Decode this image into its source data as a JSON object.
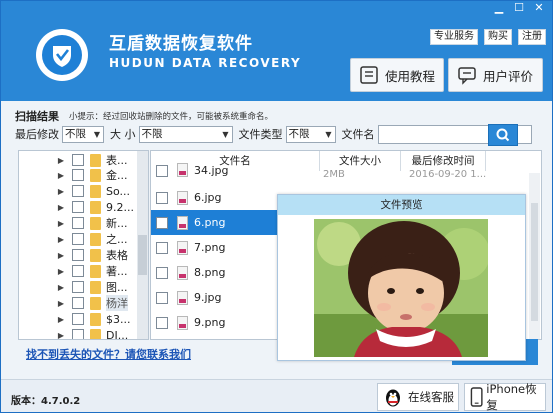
{
  "window": {
    "title_cn": "互盾数据恢复软件",
    "title_en": "HUDUN DATA RECOVERY",
    "controls": {
      "minimize": "▁",
      "maximize": "☐",
      "close": "✕"
    },
    "links": [
      "专业服务",
      "购买",
      "注册"
    ]
  },
  "header_buttons": {
    "tutorial": "使用教程",
    "review": "用户评价"
  },
  "search": {
    "result_title": "扫描结果",
    "tip": "小提示：经过回收站删除的文件，可能被系统重命名。",
    "modified_label": "最后修改",
    "modified_value": "不限",
    "size_label": "大 小",
    "size_value": "不限",
    "type_label": "文件类型",
    "type_value": "不限",
    "name_label": "文件名",
    "name_value": ""
  },
  "tree": {
    "items": [
      "表...",
      "金...",
      "So...",
      "9.2...",
      "新...",
      "之...",
      "表格",
      "著...",
      "图...",
      "杨洋",
      "$3...",
      "DI..."
    ]
  },
  "file_list": {
    "headers": {
      "name": "文件名",
      "size": "文件大小",
      "modified": "最后修改时间"
    },
    "partial_row": {
      "name": "34.jpg",
      "size": "2MB",
      "date": "2016-09-20 1..."
    },
    "rows": [
      {
        "name": "6.jpg",
        "selected": false
      },
      {
        "name": "6.png",
        "selected": true
      },
      {
        "name": "7.png",
        "selected": false
      },
      {
        "name": "8.png",
        "selected": false
      },
      {
        "name": "9.jpg",
        "selected": false
      },
      {
        "name": "9.png",
        "selected": false
      }
    ]
  },
  "preview": {
    "title": "文件预览"
  },
  "footer": {
    "help_link": "找不到丢失的文件？请您联系我们",
    "version": "版本：4.7.0.2",
    "online_service": "在线客服",
    "iphone_recovery": "iPhone恢复"
  },
  "colors": {
    "brand_blue": "#2a87d6",
    "selection_blue": "#1e7fd6",
    "folder_yellow": "#f1c14a"
  },
  "icons": [
    "shield-logo-icon",
    "book-icon",
    "chat-icon",
    "search-icon",
    "folder-icon",
    "image-file-icon",
    "penguin-icon",
    "phone-icon"
  ]
}
